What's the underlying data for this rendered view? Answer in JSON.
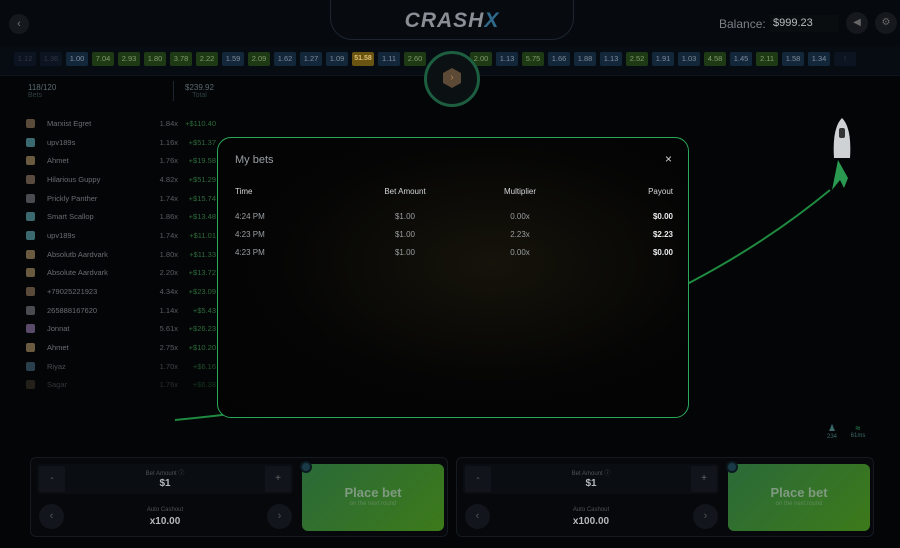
{
  "header": {
    "logo": "CRASH",
    "logo_accent": "X",
    "balance_label": "Balance:",
    "balance_value": "$999.23"
  },
  "history": [
    {
      "v": "1.12",
      "c": "faint"
    },
    {
      "v": "1.36",
      "c": "faint"
    },
    {
      "v": "1.00",
      "c": "blue"
    },
    {
      "v": "7.04",
      "c": "green"
    },
    {
      "v": "2.93",
      "c": "green"
    },
    {
      "v": "1.80",
      "c": "green"
    },
    {
      "v": "3.78",
      "c": "green"
    },
    {
      "v": "2.22",
      "c": "green"
    },
    {
      "v": "1.59",
      "c": "blue"
    },
    {
      "v": "2.09",
      "c": "green"
    },
    {
      "v": "1.62",
      "c": "blue"
    },
    {
      "v": "1.27",
      "c": "blue"
    },
    {
      "v": "1.09",
      "c": "blue"
    },
    {
      "v": "51.58",
      "c": "gold"
    },
    {
      "v": "1.11",
      "c": "blue"
    },
    {
      "v": "2.60",
      "c": "green"
    },
    {
      "v": "2.00",
      "c": "green"
    },
    {
      "v": "1.13",
      "c": "blue"
    },
    {
      "v": "5.75",
      "c": "green"
    },
    {
      "v": "1.66",
      "c": "blue"
    },
    {
      "v": "1.88",
      "c": "blue"
    },
    {
      "v": "1.13",
      "c": "blue"
    },
    {
      "v": "2.52",
      "c": "green"
    },
    {
      "v": "1.91",
      "c": "blue"
    },
    {
      "v": "1.03",
      "c": "blue"
    },
    {
      "v": "4.58",
      "c": "green"
    },
    {
      "v": "1.45",
      "c": "blue"
    },
    {
      "v": "2.11",
      "c": "green"
    },
    {
      "v": "1.58",
      "c": "blue"
    },
    {
      "v": "1.34",
      "c": "blue"
    },
    {
      "v": "!",
      "c": "faint"
    }
  ],
  "stats": {
    "bets_value": "118/120",
    "bets_label": "Bets",
    "total_value": "$239.92",
    "total_label": "Total"
  },
  "players": [
    {
      "name": "Marxist Egret",
      "mult": "1.84x",
      "win": "+$110.40"
    },
    {
      "name": "upv189s",
      "mult": "1.16x",
      "win": "+$51.37"
    },
    {
      "name": "Ahmet",
      "mult": "1.76x",
      "win": "+$19.58"
    },
    {
      "name": "Hilarious Guppy",
      "mult": "4.82x",
      "win": "+$51.29"
    },
    {
      "name": "Prickly Panther",
      "mult": "1.74x",
      "win": "+$15.74"
    },
    {
      "name": "Smart Scallop",
      "mult": "1.86x",
      "win": "+$13.48"
    },
    {
      "name": "upv189s",
      "mult": "1.74x",
      "win": "+$11.01"
    },
    {
      "name": "Absolutb Aardvark",
      "mult": "1.80x",
      "win": "+$11.33"
    },
    {
      "name": "Absolute Aardvark",
      "mult": "2.20x",
      "win": "+$13.72"
    },
    {
      "name": "+79025221923",
      "mult": "4.34x",
      "win": "+$23.09"
    },
    {
      "name": "265888167620",
      "mult": "1.14x",
      "win": "+$5.43"
    },
    {
      "name": "Jonnat",
      "mult": "5.61x",
      "win": "+$26.23"
    },
    {
      "name": "Ahmet",
      "mult": "2.75x",
      "win": "+$10.20"
    },
    {
      "name": "Riyaz",
      "mult": "1.70x",
      "win": "+$6.16"
    },
    {
      "name": "Sagar",
      "mult": "1.76x",
      "win": "+$6.38"
    }
  ],
  "modal": {
    "title": "My bets",
    "close": "×",
    "columns": [
      "Time",
      "Bet Amount",
      "Multiplier",
      "Payout"
    ],
    "rows": [
      {
        "time": "4:24 PM",
        "amount": "$1.00",
        "mult": "0.00x",
        "payout": "$0.00"
      },
      {
        "time": "4:23 PM",
        "amount": "$1.00",
        "mult": "2.23x",
        "payout": "$2.23"
      },
      {
        "time": "4:23 PM",
        "amount": "$1.00",
        "mult": "0.00x",
        "payout": "$0.00"
      }
    ]
  },
  "indicators": {
    "players": "234",
    "ping": "61ms"
  },
  "panels": [
    {
      "minus": "-",
      "plus": "+",
      "bet_label": "Bet Amount ⓘ",
      "bet_value": "$1",
      "auto_label": "Auto Cashout",
      "auto_value": "x10.00",
      "place": "Place bet",
      "place_sub": "on the next round"
    },
    {
      "minus": "-",
      "plus": "+",
      "bet_label": "Bet Amount ⓘ",
      "bet_value": "$1",
      "auto_label": "Auto Cashout",
      "auto_value": "x100.00",
      "place": "Place bet",
      "place_sub": "on the next round"
    }
  ]
}
